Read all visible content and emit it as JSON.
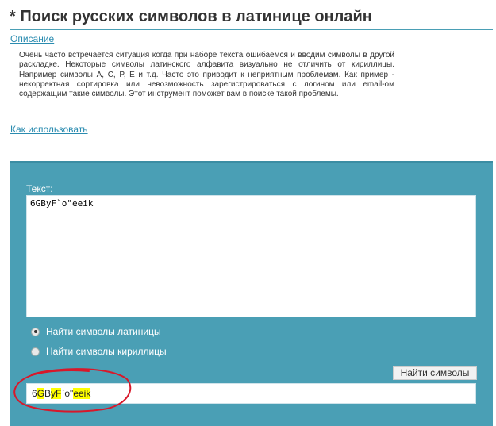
{
  "page": {
    "title": "* Поиск русских символов в латинице онлайн"
  },
  "links": {
    "description": "Описание",
    "how_to_use": "Как использовать"
  },
  "description_text": "Очень часто встречается ситуация когда при наборе текста ошибаемся и вводим символы в другой раскладке. Некоторые символы латинского алфавита визуально не отличить от кириллицы. Например символы A, C, P, E и т.д. Часто это приводит к неприятным проблемам. Как пример - некорректная сортировка или невозможность зарегистрироваться с логином или email-ом содержащим такие символы. Этот инструмент поможет вам в поиске такой проблемы.",
  "form": {
    "text_label": "Текст:",
    "text_value": "6GByF`o\"eeik",
    "radio_latin_label": "Найти символы латиницы",
    "radio_cyrillic_label": "Найти символы кириллицы",
    "selected_mode": "latin",
    "find_button_label": "Найти символы",
    "result_segments": [
      {
        "text": "6",
        "highlight": false
      },
      {
        "text": "G",
        "highlight": true
      },
      {
        "text": "B",
        "highlight": false
      },
      {
        "text": "yF",
        "highlight": true
      },
      {
        "text": "`o\"",
        "highlight": false
      },
      {
        "text": "eeik",
        "highlight": true
      }
    ]
  },
  "colors": {
    "accent": "#4a9fb5",
    "link": "#2b8cb0",
    "highlight": "#ffff00",
    "annotation": "#d8182a"
  }
}
